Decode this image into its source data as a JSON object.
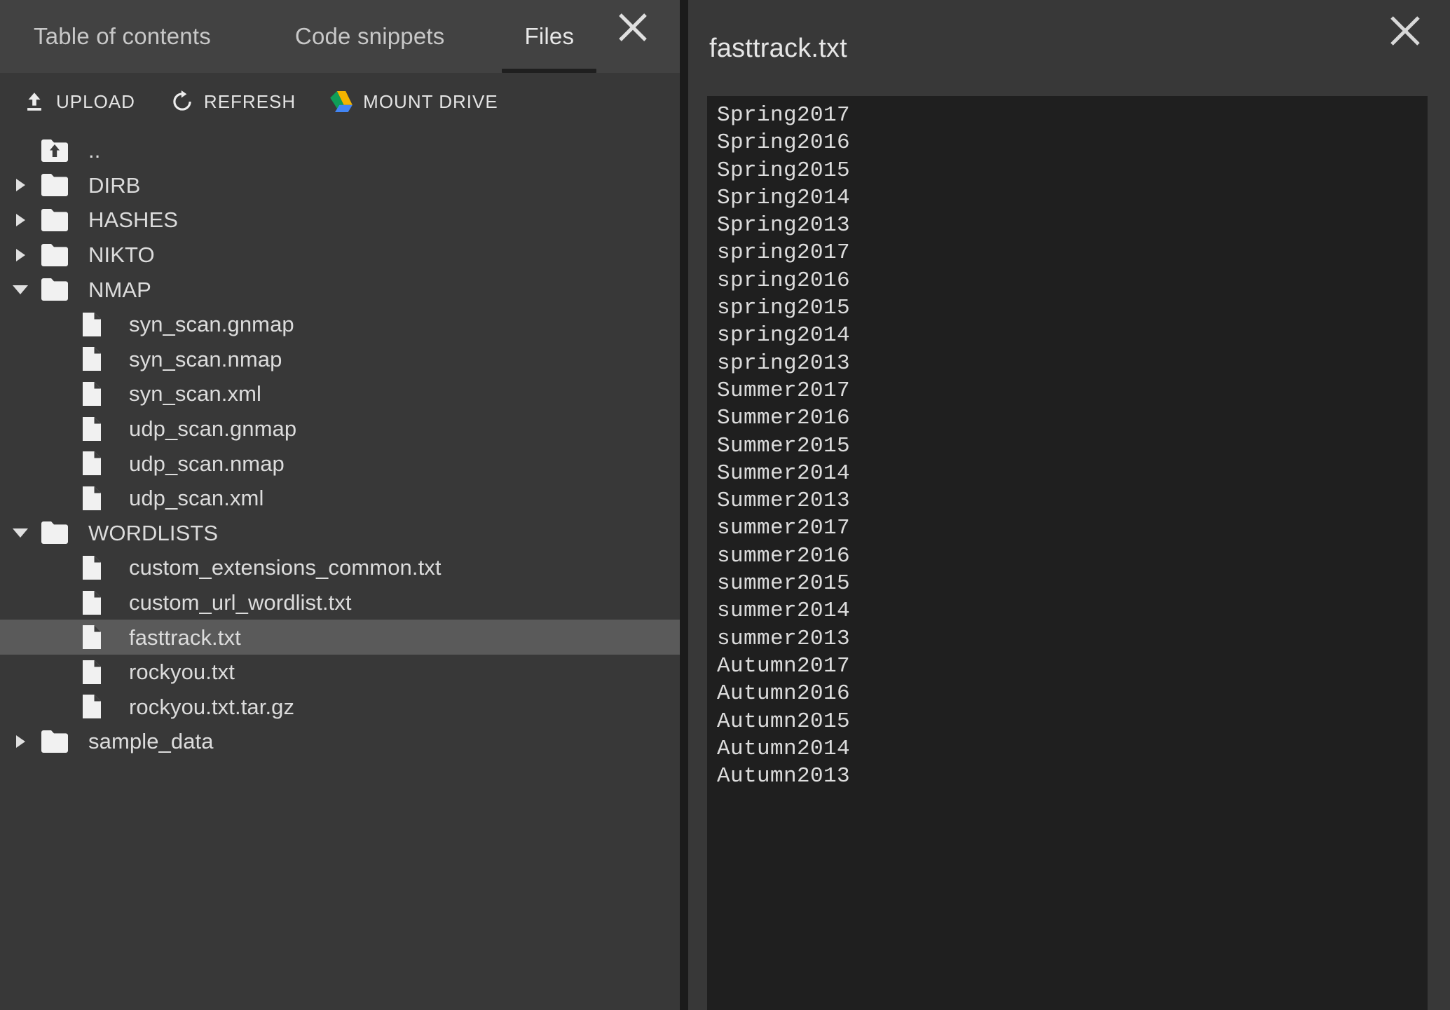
{
  "panel": {
    "tabs": [
      {
        "label": "Table of contents",
        "active": false,
        "name": "tab-table-of-contents"
      },
      {
        "label": "Code snippets",
        "active": false,
        "name": "tab-code-snippets"
      },
      {
        "label": "Files",
        "active": true,
        "name": "tab-files"
      }
    ],
    "close_icon": "close-icon"
  },
  "toolbar": {
    "upload_label": "UPLOAD",
    "refresh_label": "REFRESH",
    "mount_drive_label": "MOUNT DRIVE",
    "upload_icon": "upload-icon",
    "refresh_icon": "refresh-icon",
    "drive_icon": "google-drive-icon",
    "drive_colors": {
      "green": "#0f9d58",
      "yellow": "#f4b400",
      "blue": "#4285f4"
    }
  },
  "tree": {
    "rows": [
      {
        "label": "..",
        "type": "parent",
        "depth": 0,
        "caret": "none",
        "selected": false
      },
      {
        "label": "DIRB",
        "type": "folder",
        "depth": 0,
        "caret": "collapsed",
        "selected": false
      },
      {
        "label": "HASHES",
        "type": "folder",
        "depth": 0,
        "caret": "collapsed",
        "selected": false
      },
      {
        "label": "NIKTO",
        "type": "folder",
        "depth": 0,
        "caret": "collapsed",
        "selected": false
      },
      {
        "label": "NMAP",
        "type": "folder",
        "depth": 0,
        "caret": "expanded",
        "selected": false
      },
      {
        "label": "syn_scan.gnmap",
        "type": "file",
        "depth": 1,
        "caret": "none",
        "selected": false
      },
      {
        "label": "syn_scan.nmap",
        "type": "file",
        "depth": 1,
        "caret": "none",
        "selected": false
      },
      {
        "label": "syn_scan.xml",
        "type": "file",
        "depth": 1,
        "caret": "none",
        "selected": false
      },
      {
        "label": "udp_scan.gnmap",
        "type": "file",
        "depth": 1,
        "caret": "none",
        "selected": false
      },
      {
        "label": "udp_scan.nmap",
        "type": "file",
        "depth": 1,
        "caret": "none",
        "selected": false
      },
      {
        "label": "udp_scan.xml",
        "type": "file",
        "depth": 1,
        "caret": "none",
        "selected": false
      },
      {
        "label": "WORDLISTS",
        "type": "folder",
        "depth": 0,
        "caret": "expanded",
        "selected": false
      },
      {
        "label": "custom_extensions_common.txt",
        "type": "file",
        "depth": 1,
        "caret": "none",
        "selected": false
      },
      {
        "label": "custom_url_wordlist.txt",
        "type": "file",
        "depth": 1,
        "caret": "none",
        "selected": false
      },
      {
        "label": "fasttrack.txt",
        "type": "file",
        "depth": 1,
        "caret": "none",
        "selected": true
      },
      {
        "label": "rockyou.txt",
        "type": "file",
        "depth": 1,
        "caret": "none",
        "selected": false
      },
      {
        "label": "rockyou.txt.tar.gz",
        "type": "file",
        "depth": 1,
        "caret": "none",
        "selected": false
      },
      {
        "label": "sample_data",
        "type": "folder",
        "depth": 0,
        "caret": "collapsed",
        "selected": false
      }
    ]
  },
  "editor": {
    "title": "fasttrack.txt",
    "close_icon": "close-icon",
    "lines": [
      "Spring2017",
      "Spring2016",
      "Spring2015",
      "Spring2014",
      "Spring2013",
      "spring2017",
      "spring2016",
      "spring2015",
      "spring2014",
      "spring2013",
      "Summer2017",
      "Summer2016",
      "Summer2015",
      "Summer2014",
      "Summer2013",
      "summer2017",
      "summer2016",
      "summer2015",
      "summer2014",
      "summer2013",
      "Autumn2017",
      "Autumn2016",
      "Autumn2015",
      "Autumn2014",
      "Autumn2013"
    ]
  },
  "colors": {
    "panel_bg": "#383838",
    "tabbar_bg": "#424242",
    "editor_code_bg": "#1f1f1f",
    "selected_row": "#5a5a5a",
    "text": "#dcdcdc",
    "divider": "#1b1b1b"
  }
}
